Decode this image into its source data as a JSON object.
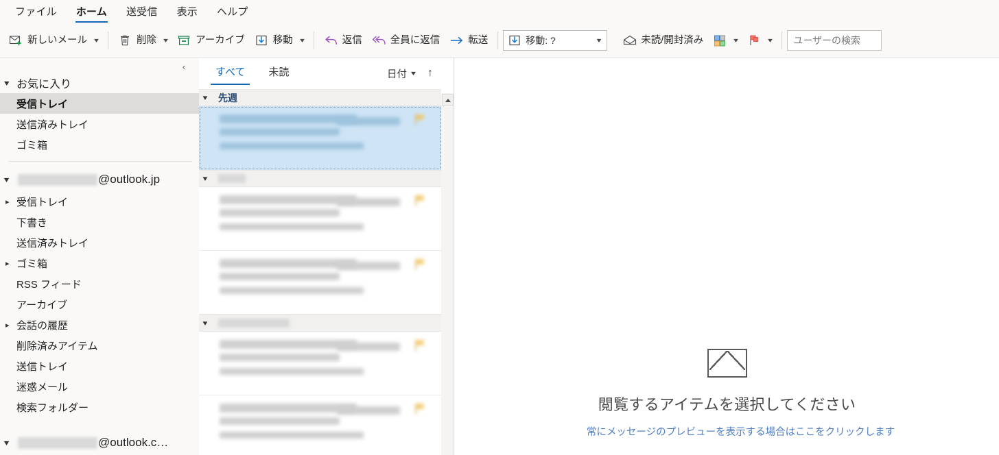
{
  "ribbon": {
    "tabs": [
      {
        "label": "ファイル",
        "active": false
      },
      {
        "label": "ホーム",
        "active": true
      },
      {
        "label": "送受信",
        "active": false
      },
      {
        "label": "表示",
        "active": false
      },
      {
        "label": "ヘルプ",
        "active": false
      }
    ]
  },
  "toolbar": {
    "new_mail": "新しいメール",
    "delete": "削除",
    "archive": "アーカイブ",
    "move": "移動",
    "reply": "返信",
    "reply_all": "全員に返信",
    "forward": "転送",
    "move_combo_value": "移動: ?",
    "unread_read": "未読/開封済み",
    "search_placeholder": "ユーザーの検索",
    "icons": {
      "new_mail": "new-mail-icon",
      "delete": "trash-icon",
      "archive": "archive-icon",
      "move": "move-to-folder-icon",
      "reply": "reply-arrow-icon",
      "reply_all": "reply-all-arrow-icon",
      "forward": "forward-arrow-icon",
      "unread_read": "open-envelope-icon",
      "categorize": "categorize-grid-icon",
      "flag": "flag-icon",
      "caret": "chevron-down-icon"
    }
  },
  "sidebar": {
    "collapse_icon": "chevron-left-icon",
    "favorites": {
      "label": "お気に入り",
      "items": [
        {
          "label": "受信トレイ",
          "selected": true,
          "expandable": false
        },
        {
          "label": "送信済みトレイ",
          "selected": false,
          "expandable": false
        },
        {
          "label": "ゴミ箱",
          "selected": false,
          "expandable": false
        }
      ]
    },
    "accounts": [
      {
        "redacted_name": "",
        "domain": "@outlook.jp",
        "expanded": true,
        "items": [
          {
            "label": "受信トレイ",
            "expandable": true
          },
          {
            "label": "下書き",
            "expandable": false
          },
          {
            "label": "送信済みトレイ",
            "expandable": false
          },
          {
            "label": "ゴミ箱",
            "expandable": true
          },
          {
            "label": "RSS フィード",
            "expandable": false
          },
          {
            "label": "アーカイブ",
            "expandable": false
          },
          {
            "label": "会話の履歴",
            "expandable": true
          },
          {
            "label": "削除済みアイテム",
            "expandable": false
          },
          {
            "label": "送信トレイ",
            "expandable": false
          },
          {
            "label": "迷惑メール",
            "expandable": false
          },
          {
            "label": "検索フォルダー",
            "expandable": false
          }
        ]
      },
      {
        "redacted_name": "",
        "domain": "@outlook.c…",
        "expanded": true,
        "items": []
      }
    ]
  },
  "message_list": {
    "tabs": [
      {
        "label": "すべて",
        "active": true
      },
      {
        "label": "未読",
        "active": false
      }
    ],
    "sort_label": "日付",
    "sort_caret": "chevron-down-icon",
    "sort_direction_icon": "arrow-up-icon",
    "scroll_up_icon": "scroll-up-arrow-icon",
    "groups": [
      {
        "label": "先週",
        "redacted": false,
        "redacted_width": 0,
        "messages": [
          {
            "selected": true,
            "flagged": true
          }
        ]
      },
      {
        "label": "",
        "redacted": true,
        "redacted_width": 40,
        "messages": [
          {
            "selected": false,
            "flagged": true
          },
          {
            "selected": false,
            "flagged": true
          }
        ]
      },
      {
        "label": "",
        "redacted": true,
        "redacted_width": 104,
        "messages": [
          {
            "selected": false,
            "flagged": true
          },
          {
            "selected": false,
            "flagged": true
          }
        ]
      }
    ]
  },
  "reading_pane": {
    "empty_icon": "envelope-icon",
    "empty_title": "閲覧するアイテムを選択してください",
    "empty_link": "常にメッセージのプレビューを表示する場合はここをクリックします"
  },
  "colors": {
    "accent_blue": "#1266b5",
    "selection_blue": "#cfe5f6",
    "group_header_text": "#2a4b72",
    "link_blue": "#4f7fc4",
    "archive_green": "#107c41",
    "reply_purple": "#8764b8",
    "forward_blue": "#0f6cbd",
    "flag_red": "#e8554d",
    "sidebar_bg": "#faf9f8",
    "selected_folder_bg": "#dedcdb"
  }
}
